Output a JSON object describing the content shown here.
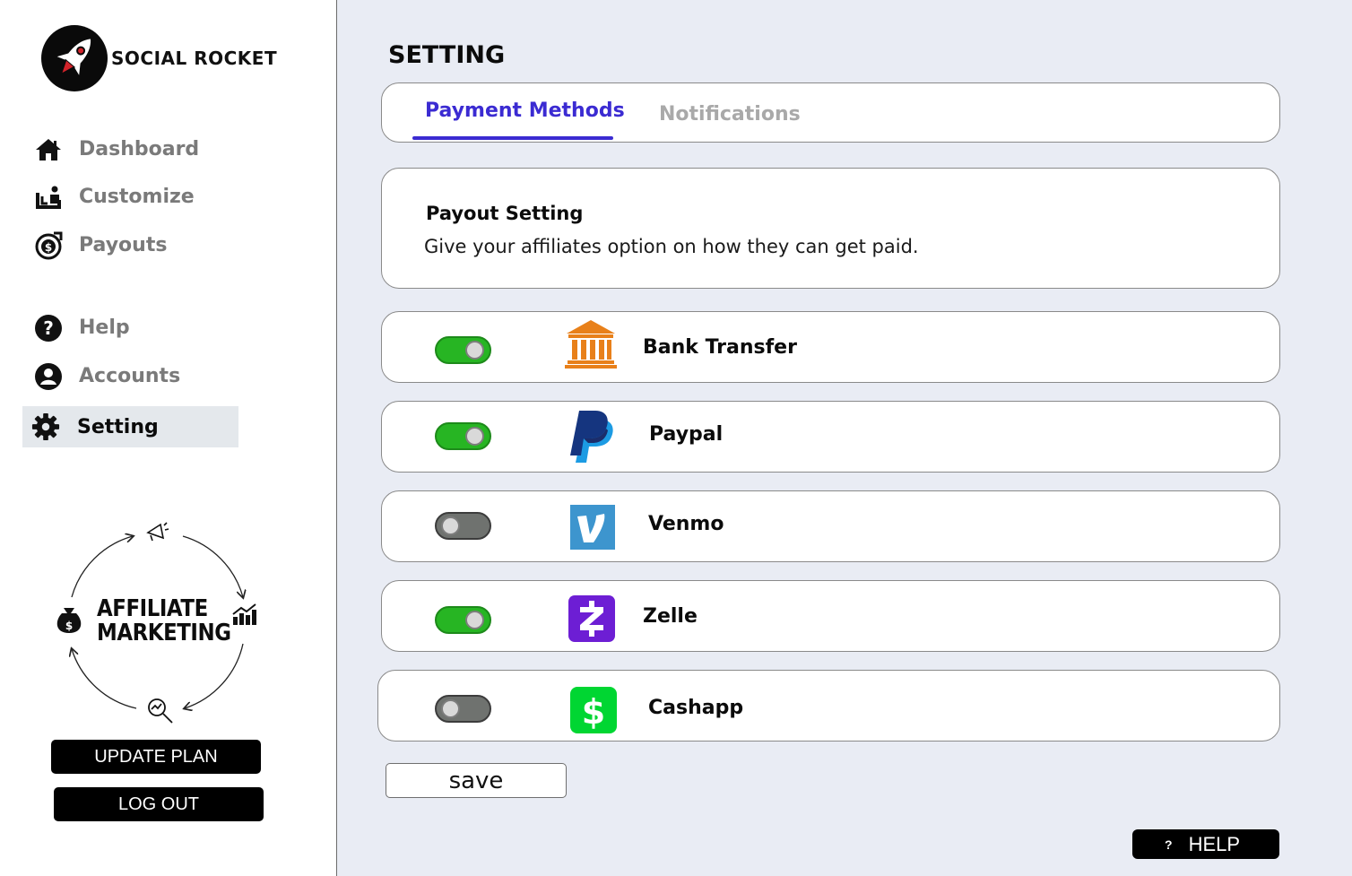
{
  "brand": {
    "name": "SOCIAL ROCKET",
    "logo_icon": "rocket-icon"
  },
  "sidebar": {
    "items": [
      {
        "label": "Dashboard",
        "icon": "home-icon",
        "active": false
      },
      {
        "label": "Customize",
        "icon": "customize-icon",
        "active": false
      },
      {
        "label": "Payouts",
        "icon": "payout-coin-icon",
        "active": false
      },
      {
        "label": "Help",
        "icon": "question-circle-icon",
        "active": false
      },
      {
        "label": "Accounts",
        "icon": "user-circle-icon",
        "active": false
      },
      {
        "label": "Setting",
        "icon": "gear-icon",
        "active": true
      }
    ],
    "illustration": {
      "line1": "AFFILIATE",
      "line2": "MARKETING"
    },
    "update_plan_label": "UPDATE PLAN",
    "logout_label": "LOG OUT"
  },
  "main": {
    "title": "SETTING",
    "tabs": [
      {
        "label": "Payment Methods",
        "active": true
      },
      {
        "label": "Notifications",
        "active": false
      }
    ],
    "payout": {
      "title": "Payout Setting",
      "description": "Give your affiliates option on how they can get paid."
    },
    "methods": [
      {
        "name": "Bank Transfer",
        "enabled": true,
        "icon": "bank-icon"
      },
      {
        "name": "Paypal",
        "enabled": true,
        "icon": "paypal-icon"
      },
      {
        "name": "Venmo",
        "enabled": false,
        "icon": "venmo-icon"
      },
      {
        "name": "Zelle",
        "enabled": true,
        "icon": "zelle-icon"
      },
      {
        "name": "Cashapp",
        "enabled": false,
        "icon": "cashapp-icon"
      }
    ],
    "save_label": "save",
    "help_label": "HELP",
    "help_icon_glyph": "?"
  },
  "colors": {
    "accent": "#3b2bd2",
    "toggle_on": "#27b523",
    "toggle_off": "#6f726f",
    "page_bg": "#e9ecf4"
  }
}
